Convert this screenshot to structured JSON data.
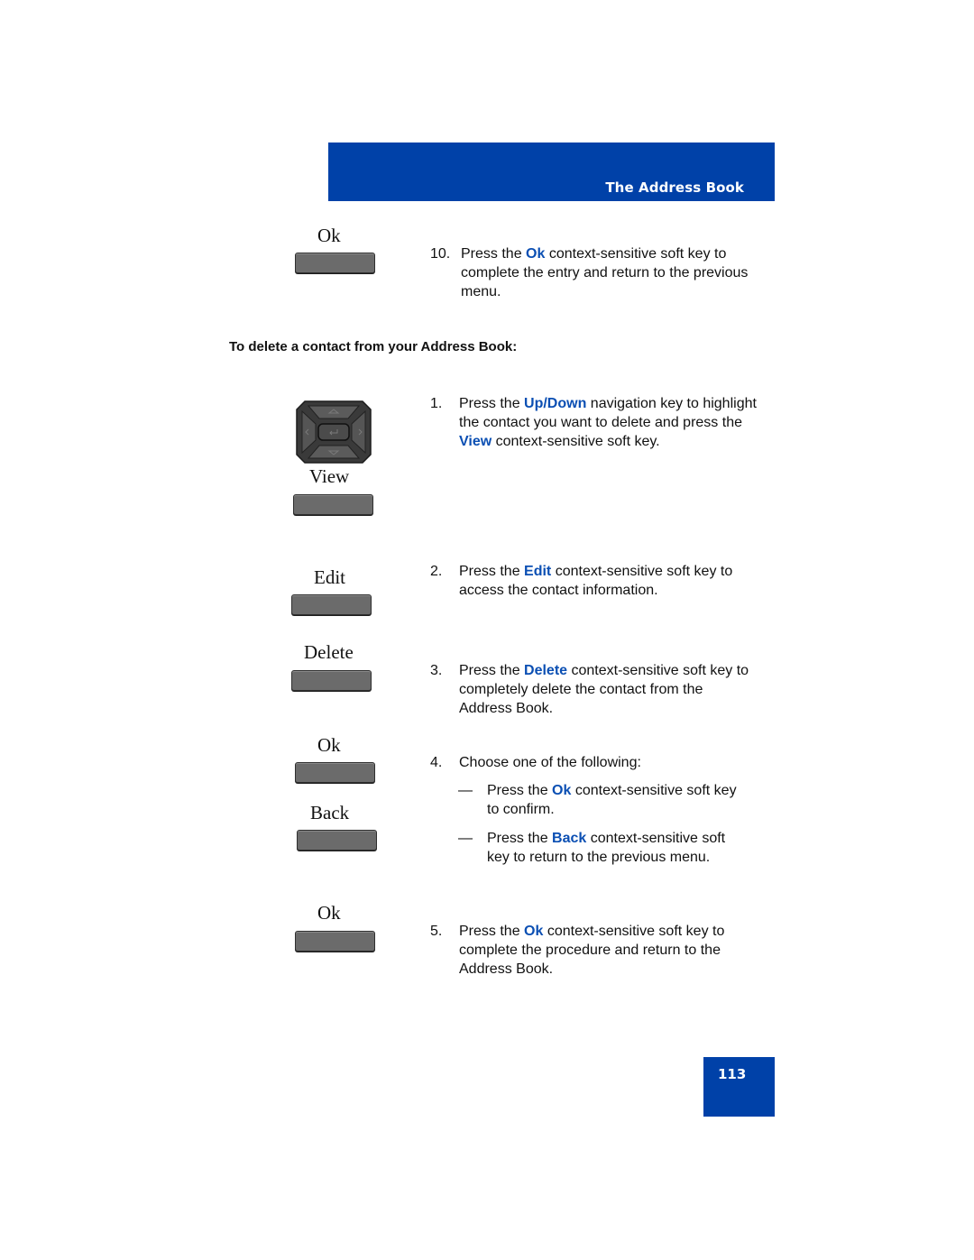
{
  "header": {
    "title": "The Address Book",
    "color": "#0041a8"
  },
  "section_heading": "To delete a contact from your Address Book:",
  "keys": {
    "ok_top": "Ok",
    "view": "View",
    "edit": "Edit",
    "delete": "Delete",
    "ok_confirm": "Ok",
    "back": "Back",
    "ok_final": "Ok"
  },
  "steps": {
    "s10": {
      "num": "10.",
      "pre": "Press the ",
      "key": "Ok",
      "post": " context-sensitive soft key to complete the entry and return to the previous menu."
    },
    "s1": {
      "num": "1.",
      "pre": "Press the ",
      "key1": "Up/Down",
      "mid": " navigation key to highlight the contact you want to delete and press the ",
      "key2": "View",
      "post": " context-sensitive soft key."
    },
    "s2": {
      "num": "2.",
      "pre": "Press the ",
      "key": "Edit",
      "post": " context-sensitive soft key to access the contact information."
    },
    "s3": {
      "num": "3.",
      "pre": "Press the ",
      "key": "Delete",
      "post": " context-sensitive soft key to completely delete the contact from the Address Book."
    },
    "s4": {
      "num": "4.",
      "text": "Choose one of the following:",
      "options": [
        {
          "dash": "—",
          "pre": "Press the ",
          "key": "Ok",
          "post": " context-sensitive soft key to confirm."
        },
        {
          "dash": "—",
          "pre": "Press the ",
          "key": "Back",
          "post": " context-sensitive soft key to return to the previous menu."
        }
      ]
    },
    "s5": {
      "num": "5.",
      "pre": "Press the ",
      "key": "Ok",
      "post": " context-sensitive soft key to complete the procedure and return to the Address Book."
    }
  },
  "page_number": "113",
  "accent_color": "#0b4fb3"
}
